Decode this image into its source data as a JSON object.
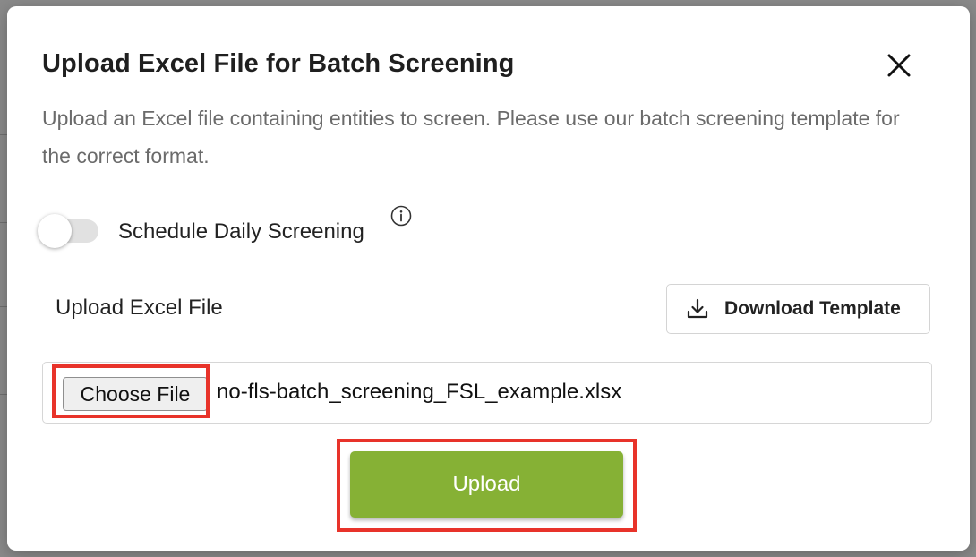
{
  "modal": {
    "title": "Upload Excel File for Batch Screening",
    "description": "Upload an Excel file containing entities to screen. Please use our batch screening template for the correct format.",
    "close_icon": "close-icon"
  },
  "schedule": {
    "label": "Schedule Daily Screening",
    "enabled": false,
    "info_icon": "info-icon"
  },
  "upload_section": {
    "label": "Upload Excel File",
    "download_button_label": "Download Template",
    "download_icon": "download-icon",
    "choose_file_label": "Choose File",
    "file_name": "no-fls-batch_screening_FSL_example.xlsx",
    "upload_button_label": "Upload"
  },
  "colors": {
    "upload_button": "#86b135",
    "highlight": "#e8332a",
    "toggle_track": "#e1e1e1"
  }
}
